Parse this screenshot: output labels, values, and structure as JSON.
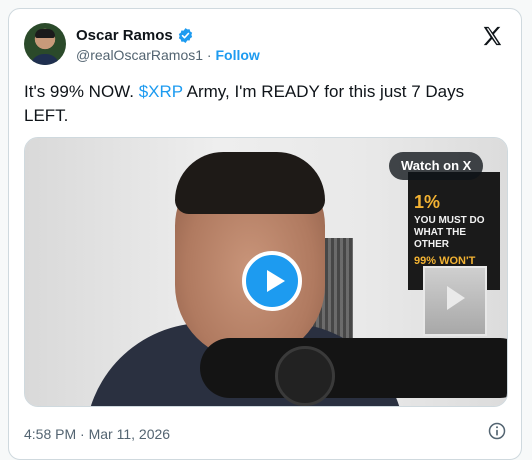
{
  "author": {
    "name": "Oscar Ramos",
    "handle": "@realOscarRamos1",
    "separator": "·",
    "follow_label": "Follow"
  },
  "tweet": {
    "text_before": "It's 99% NOW. ",
    "cashtag": "$XRP",
    "text_after": " Army, I'm READY for this just 7 Days LEFT."
  },
  "media": {
    "watch_label": "Watch on X",
    "poster_line1": "1%",
    "poster_line2": "YOU MUST DO WHAT THE OTHER",
    "poster_line3": "99% WON'T"
  },
  "footer": {
    "time": "4:58 PM",
    "separator": "·",
    "date": "Mar 11, 2026"
  },
  "icons": {
    "verified": "verified-badge-icon",
    "logo": "x-logo-icon",
    "play": "play-icon",
    "info": "info-icon"
  },
  "colors": {
    "accent": "#1d9bf0",
    "text": "#0f1419",
    "muted": "#536471"
  }
}
